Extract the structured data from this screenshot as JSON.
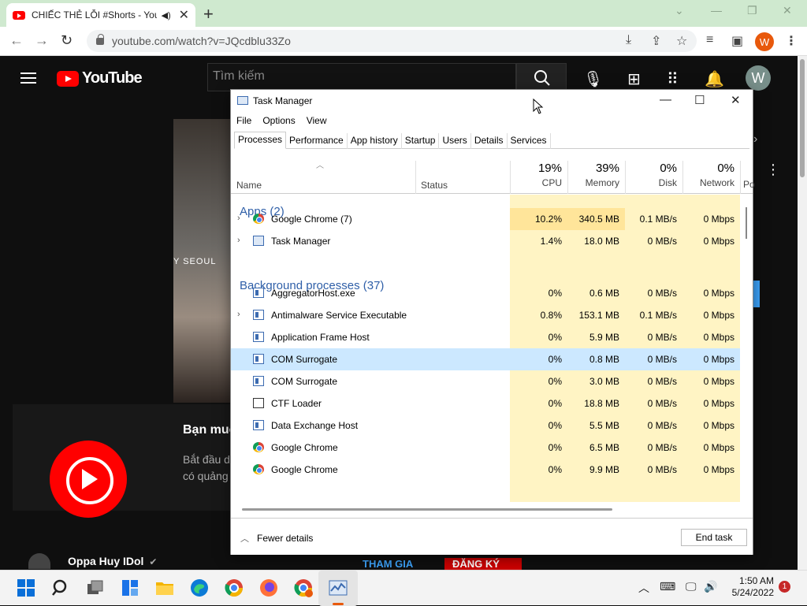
{
  "browser": {
    "tab_title": "CHIẾC THẺ LỖI #Shorts - You",
    "tab_audio_icon": "speaker-icon",
    "url": "youtube.com/watch?v=JQcdblu33Zo",
    "profile_initial": "W",
    "profile_color": "#e8590c"
  },
  "youtube": {
    "logo_text": "YouTube",
    "search_placeholder": "Tìm kiếm",
    "avatar_initial": "W",
    "promo_heading": "Bạn muố",
    "promo_line1": "Bắt đầu d",
    "promo_line2": "có quảng",
    "channel_name": "Oppa Huy IDol",
    "join_label": "THAM GIA",
    "subscribe_label": "ĐĂNG KÝ",
    "video_sign": "Y SEOUL"
  },
  "task_manager": {
    "title": "Task Manager",
    "menu": [
      "File",
      "Options",
      "View"
    ],
    "tabs": [
      "Processes",
      "Performance",
      "App history",
      "Startup",
      "Users",
      "Details",
      "Services"
    ],
    "active_tab": "Processes",
    "columns": {
      "name": "Name",
      "status": "Status",
      "cpu_pct": "19%",
      "cpu_label": "CPU",
      "mem_pct": "39%",
      "mem_label": "Memory",
      "disk_pct": "0%",
      "disk_label": "Disk",
      "net_pct": "0%",
      "net_label": "Network",
      "power_label": "Po"
    },
    "groups": {
      "apps": "Apps (2)",
      "background": "Background processes (37)"
    },
    "apps": [
      {
        "name": "Google Chrome (7)",
        "icon": "chrome-icon",
        "expandable": true,
        "cpu": "10.2%",
        "memory": "340.5 MB",
        "disk": "0.1 MB/s",
        "network": "0 Mbps"
      },
      {
        "name": "Task Manager",
        "icon": "task-manager-icon",
        "expandable": true,
        "cpu": "1.4%",
        "memory": "18.0 MB",
        "disk": "0 MB/s",
        "network": "0 Mbps"
      }
    ],
    "background": [
      {
        "name": "AggregatorHost.exe",
        "icon": "window-icon",
        "expandable": false,
        "cpu": "0%",
        "memory": "0.6 MB",
        "disk": "0 MB/s",
        "network": "0 Mbps"
      },
      {
        "name": "Antimalware Service Executable",
        "icon": "window-icon",
        "expandable": true,
        "cpu": "0.8%",
        "memory": "153.1 MB",
        "disk": "0.1 MB/s",
        "network": "0 Mbps"
      },
      {
        "name": "Application Frame Host",
        "icon": "window-icon",
        "expandable": false,
        "cpu": "0%",
        "memory": "5.9 MB",
        "disk": "0 MB/s",
        "network": "0 Mbps"
      },
      {
        "name": "COM Surrogate",
        "icon": "window-icon",
        "expandable": false,
        "selected": true,
        "cpu": "0%",
        "memory": "0.8 MB",
        "disk": "0 MB/s",
        "network": "0 Mbps"
      },
      {
        "name": "COM Surrogate",
        "icon": "window-icon",
        "expandable": false,
        "cpu": "0%",
        "memory": "3.0 MB",
        "disk": "0 MB/s",
        "network": "0 Mbps"
      },
      {
        "name": "CTF Loader",
        "icon": "ctf-icon",
        "expandable": false,
        "cpu": "0%",
        "memory": "18.8 MB",
        "disk": "0 MB/s",
        "network": "0 Mbps"
      },
      {
        "name": "Data Exchange Host",
        "icon": "window-icon",
        "expandable": false,
        "cpu": "0%",
        "memory": "5.5 MB",
        "disk": "0 MB/s",
        "network": "0 Mbps"
      },
      {
        "name": "Google Chrome",
        "icon": "chrome-icon",
        "expandable": false,
        "cpu": "0%",
        "memory": "6.5 MB",
        "disk": "0 MB/s",
        "network": "0 Mbps"
      },
      {
        "name": "Google Chrome",
        "icon": "chrome-icon",
        "expandable": false,
        "cpu": "0%",
        "memory": "9.9 MB",
        "disk": "0 MB/s",
        "network": "0 Mbps"
      }
    ],
    "fewer_details": "Fewer details",
    "end_task": "End task"
  },
  "taskbar": {
    "time": "1:50 AM",
    "date": "5/24/2022",
    "notification_count": "1",
    "pinned": [
      "start-icon",
      "search-icon",
      "task-view-icon",
      "widgets-icon",
      "file-explorer-icon",
      "edge-icon",
      "chrome-icon",
      "firefox-icon",
      "chrome-profile-icon",
      "task-manager-icon"
    ]
  }
}
